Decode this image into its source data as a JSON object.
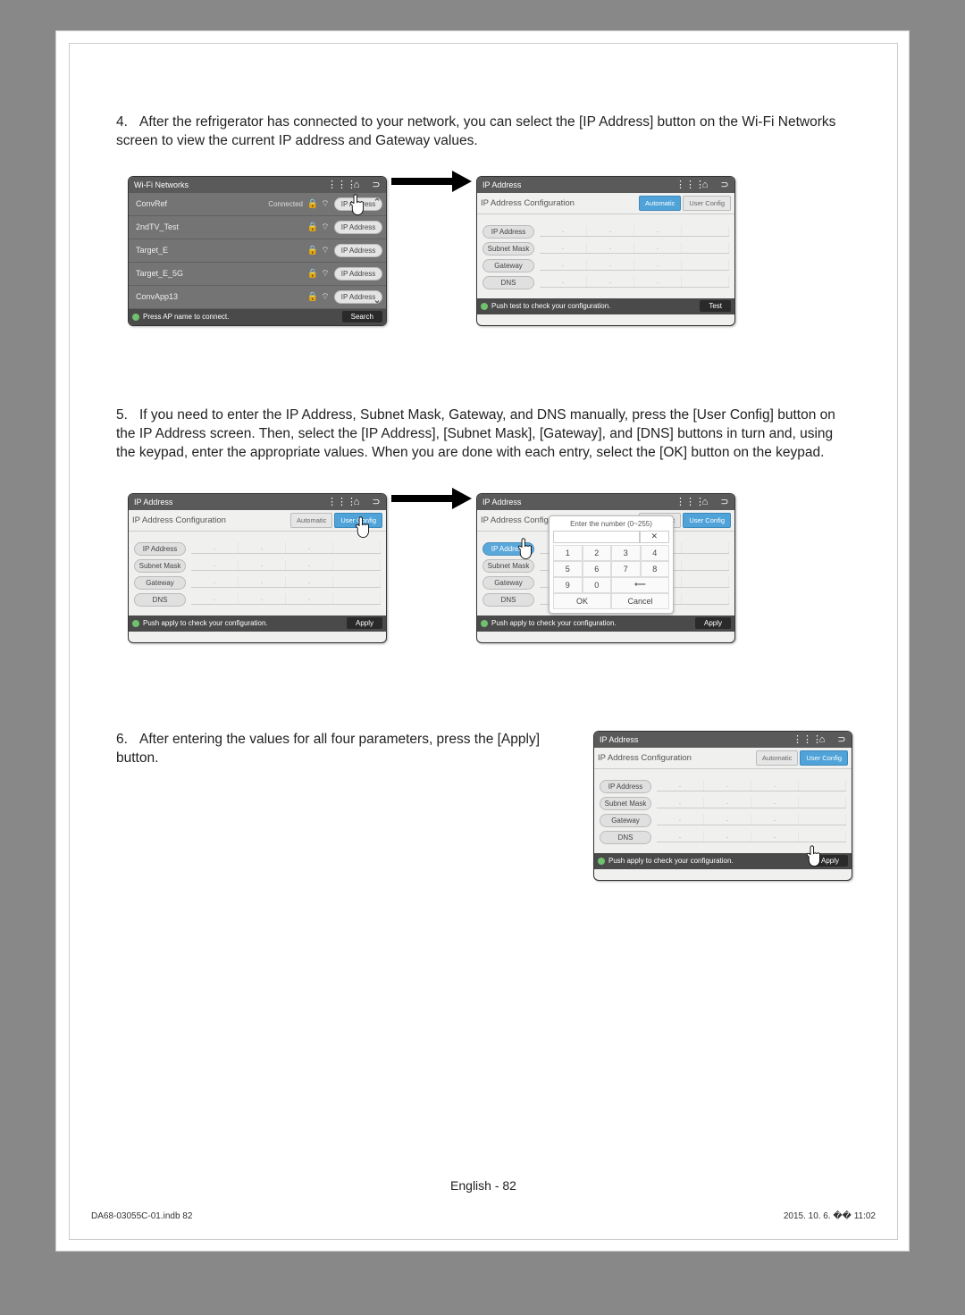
{
  "step4": {
    "num": "4.",
    "text": "After the refrigerator has connected to your network, you can select the [IP Address] button on the Wi-Fi Networks screen to view the current IP address and Gateway values."
  },
  "step5": {
    "num": "5.",
    "text": "If you need to enter the IP Address, Subnet Mask, Gateway, and DNS manually, press the [User Config] button on the IP Address screen. Then, select the [IP Address], [Subnet Mask], [Gateway], and [DNS] buttons in turn and, using the keypad, enter the appropriate values. When you are done with each entry, select the [OK] button on the keypad."
  },
  "step6": {
    "num": "6.",
    "text": "After entering the values for all four parameters, press the [Apply] button."
  },
  "wifiScreen": {
    "title": "Wi-Fi Networks",
    "rows": [
      {
        "name": "ConvRef",
        "status": "Connected",
        "ip": "IP Address"
      },
      {
        "name": "2ndTV_Test",
        "status": "",
        "ip": "IP Address"
      },
      {
        "name": "Target_E",
        "status": "",
        "ip": "IP Address"
      },
      {
        "name": "Target_E_5G",
        "status": "",
        "ip": "IP Address"
      },
      {
        "name": "ConvApp13",
        "status": "",
        "ip": "IP Address"
      }
    ],
    "footerMsg": "Press AP name to connect.",
    "footerBtn": "Search"
  },
  "ipScreen": {
    "title": "IP Address",
    "subhead": "IP Address Configuration",
    "tabAuto": "Automatic",
    "tabUser": "User Config",
    "rows": [
      "IP Address",
      "Subnet Mask",
      "Gateway",
      "DNS"
    ],
    "footerMsgTest": "Push test to check your configuration.",
    "footerMsgApply": "Push apply to check your configuration.",
    "btnTest": "Test",
    "btnApply": "Apply"
  },
  "keypad": {
    "title": "Enter the number (0~255)",
    "keys": [
      "1",
      "2",
      "3",
      "4",
      "5",
      "6",
      "7",
      "8",
      "9",
      "0"
    ],
    "ok": "OK",
    "cancel": "Cancel",
    "subheadShort": "IP Address Configu"
  },
  "icons": {
    "menu": "⋮⋮⋮",
    "home": "⌂",
    "back": "⊃",
    "lock": "🔒",
    "wifi": "⌔",
    "up": "⌃",
    "down": "⌄",
    "backspace": "⟵"
  },
  "footer": {
    "center": "English - 82",
    "left": "DA68-03055C-01.indb   82",
    "right": "2015. 10. 6.   �� 11:02"
  }
}
